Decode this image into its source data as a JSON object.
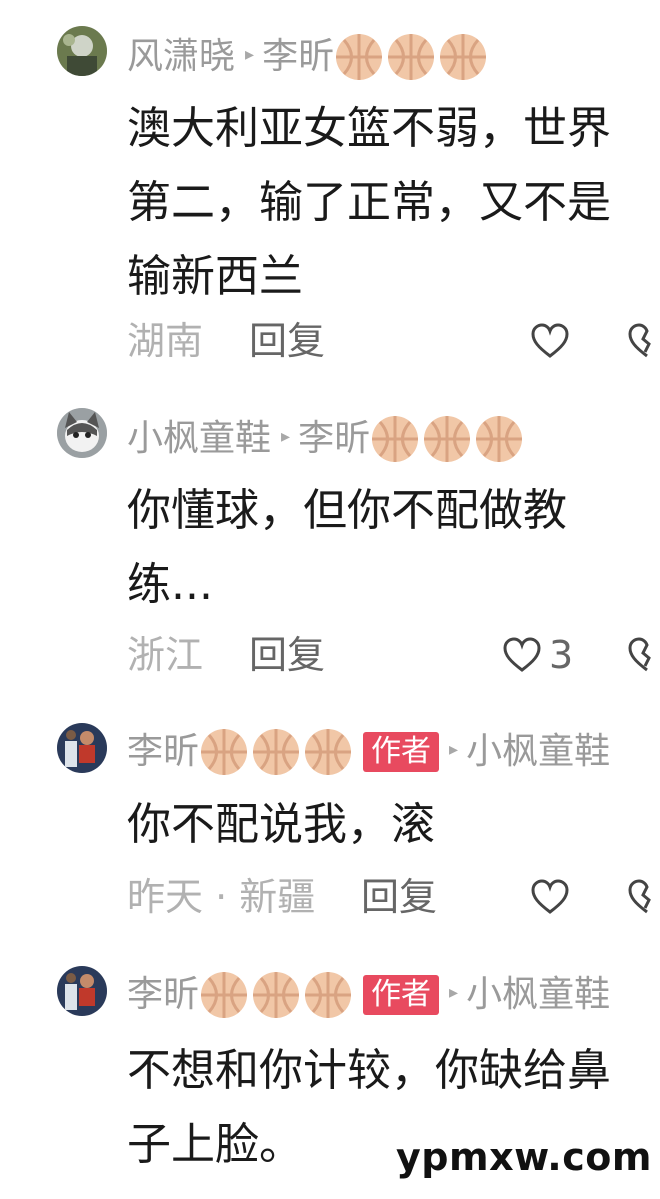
{
  "comments": [
    {
      "user": "风潇晓",
      "reply_to": "李昕",
      "is_author": false,
      "text_lines": [
        "澳大利亚女篮不弱，世界",
        "第二，输了正常，又不是",
        "输新西兰"
      ],
      "location": "湖南",
      "reply_label": "回复",
      "likes": ""
    },
    {
      "user": "小枫童鞋",
      "reply_to": "李昕",
      "is_author": false,
      "text_lines": [
        "你懂球，但你不配做教",
        "练..."
      ],
      "location": "浙江",
      "reply_label": "回复",
      "likes": "3"
    },
    {
      "user": "李昕",
      "reply_to": "小枫童鞋",
      "is_author": true,
      "author_label": "作者",
      "text_lines": [
        "你不配说我，滚"
      ],
      "location": "昨天 · 新疆",
      "reply_label": "回复",
      "likes": ""
    },
    {
      "user": "李昕",
      "reply_to": "小枫童鞋",
      "is_author": true,
      "author_label": "作者",
      "text_lines": [
        "不想和你计较，你缺给鼻",
        "子上脸。"
      ],
      "location": "",
      "reply_label": "",
      "likes": ""
    }
  ],
  "icons": {
    "arrow": "▸",
    "like": "heart-outline-icon",
    "dislike": "broken-heart-icon",
    "basketball": "basketball-emoji-icon"
  },
  "watermark": "ypmxw.com",
  "colors": {
    "author_badge": "#e84a5f",
    "basketball": "#f1c7a7",
    "muted_text": "#9a9a9a",
    "body_text": "#1a1a1a"
  }
}
